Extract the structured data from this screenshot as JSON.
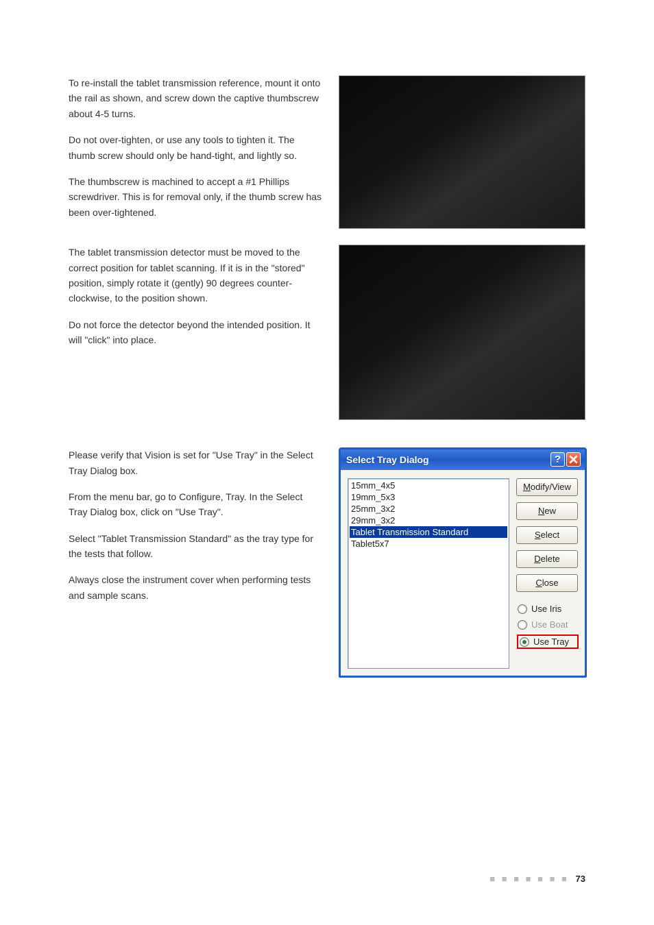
{
  "page_number": "73",
  "footer_dots": "■ ■ ■ ■ ■ ■ ■",
  "body": {
    "block1": {
      "p1": "To re-install the tablet transmission reference, mount it onto the rail as shown, and screw down the captive thumbscrew about 4-5 turns.",
      "p2": "Do not over-tighten, or use any tools to tighten it. The thumb screw should only be hand-tight, and lightly so.",
      "p3": "The thumbscrew is machined to accept a #1 Phillips screwdriver. This is for removal only, if the thumb screw has been over-tightened."
    },
    "block2": {
      "p1": "The tablet transmission detector must be moved to the correct position for tablet scanning. If it is in the \"stored\" position, simply rotate it (gently) 90 degrees counter-clockwise, to the position shown.",
      "p2": "Do not force the detector beyond the intended position. It will \"click\" into place."
    },
    "block3": {
      "p1": "Please verify that Vision is set for \"Use Tray\" in the Select Tray Dialog box.",
      "p2": "From the menu bar, go to Configure, Tray. In the Select Tray Dialog box, click on \"Use Tray\".",
      "p3": "Select \"Tablet Transmission Standard\" as the tray type for the tests that follow.",
      "p4": "Always close the instrument cover when performing tests and sample scans."
    }
  },
  "dialog": {
    "title": "Select Tray Dialog",
    "help_glyph": "?",
    "list": {
      "items": [
        "15mm_4x5",
        "19mm_5x3",
        "25mm_3x2",
        "29mm_3x2",
        "Tablet Transmission Standard",
        "Tablet5x7"
      ],
      "selected_index": 4
    },
    "buttons": {
      "modify": {
        "pre": "",
        "u": "M",
        "post": "odify/View"
      },
      "new": {
        "pre": "",
        "u": "N",
        "post": "ew"
      },
      "select": {
        "pre": "",
        "u": "S",
        "post": "elect"
      },
      "delete": {
        "pre": "",
        "u": "D",
        "post": "elete"
      },
      "close": {
        "pre": "",
        "u": "C",
        "post": "lose"
      }
    },
    "radios": {
      "iris": {
        "pre": "Use ",
        "u": "I",
        "post": "ris",
        "selected": false,
        "enabled": true
      },
      "boat": {
        "pre": "Use ",
        "u": "B",
        "post": "oat",
        "selected": false,
        "enabled": false
      },
      "tray": {
        "pre": "Use Tra",
        "u": "y",
        "post": "",
        "selected": true,
        "enabled": true,
        "highlighted": true
      }
    }
  }
}
